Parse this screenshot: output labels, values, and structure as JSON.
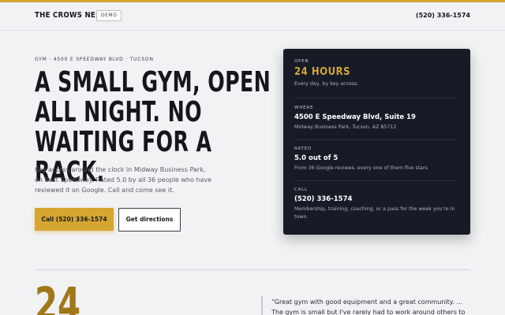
{
  "header": {
    "brand": "THE CROWS NEST",
    "badge": "DEMO",
    "phone": "(520) 336-1574"
  },
  "hero": {
    "eyebrow": "GYM · 4500 E SPEEDWAY BLVD · TUCSON",
    "headline_lines": [
      "A SMALL GYM, OPEN",
      "ALL NIGHT. NO",
      "WAITING FOR A RACK."
    ],
    "intro": "Key access around the clock in Midway Business Park, on East Speedway. Rated 5.0 by all 36 people who have reviewed it on Google. Call and come see it.",
    "call_button": "Call (520) 336-1574",
    "directions_button": "Get directions"
  },
  "card": {
    "open_label": "OPEN",
    "open_value": "24 HOURS",
    "open_sub": "Every day, by key access.",
    "where_label": "WHERE",
    "where_value": "4500 E Speedway Blvd, Suite 19",
    "where_sub": "Midway Business Park, Tucson, AZ 85712",
    "rated_label": "RATED",
    "rated_value": "5.0 out of 5",
    "rated_sub": "From 36 Google reviews, every one of them five stars",
    "call_label": "CALL",
    "call_value": "(520) 336-1574",
    "call_sub": "Membership, training, coaching, or a pass for the week you're in town."
  },
  "stats": {
    "big_number": "24"
  },
  "testimonial": {
    "text": "“Great gym with good equipment and a great community. ... The gym is small but I've rarely had to work around others to get my"
  },
  "colors": {
    "accent": "#d6a631",
    "card_bg": "#171b26",
    "page_bg": "#f1f2f4"
  }
}
